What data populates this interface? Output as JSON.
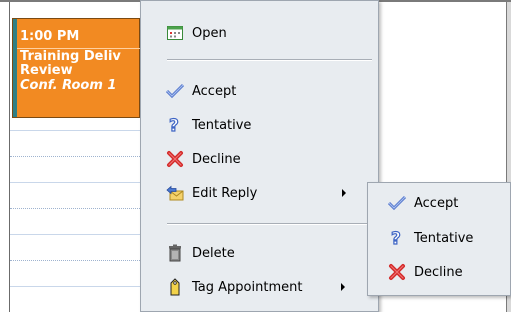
{
  "appointment": {
    "time": "1:00 PM",
    "subject": "Training Deliv\nReview",
    "location": "Conf. Room 1"
  },
  "context_menu": {
    "items": [
      {
        "label": "Open",
        "icon": "calendar-icon"
      },
      {
        "label": "Accept",
        "icon": "check-icon"
      },
      {
        "label": "Tentative",
        "icon": "question-icon"
      },
      {
        "label": "Decline",
        "icon": "x-icon"
      },
      {
        "label": "Edit Reply",
        "icon": "edit-reply-icon"
      },
      {
        "label": "Delete",
        "icon": "trash-icon"
      },
      {
        "label": "Tag Appointment",
        "icon": "tag-icon"
      }
    ]
  },
  "submenu": {
    "items": [
      {
        "label": "Accept",
        "icon": "check-icon"
      },
      {
        "label": "Tentative",
        "icon": "question-icon"
      },
      {
        "label": "Decline",
        "icon": "x-icon"
      }
    ]
  },
  "colors": {
    "appointment_bg": "#f28a22",
    "menu_bg": "#e8ecf0",
    "accept": "#5577cc",
    "decline": "#d32a2a"
  }
}
